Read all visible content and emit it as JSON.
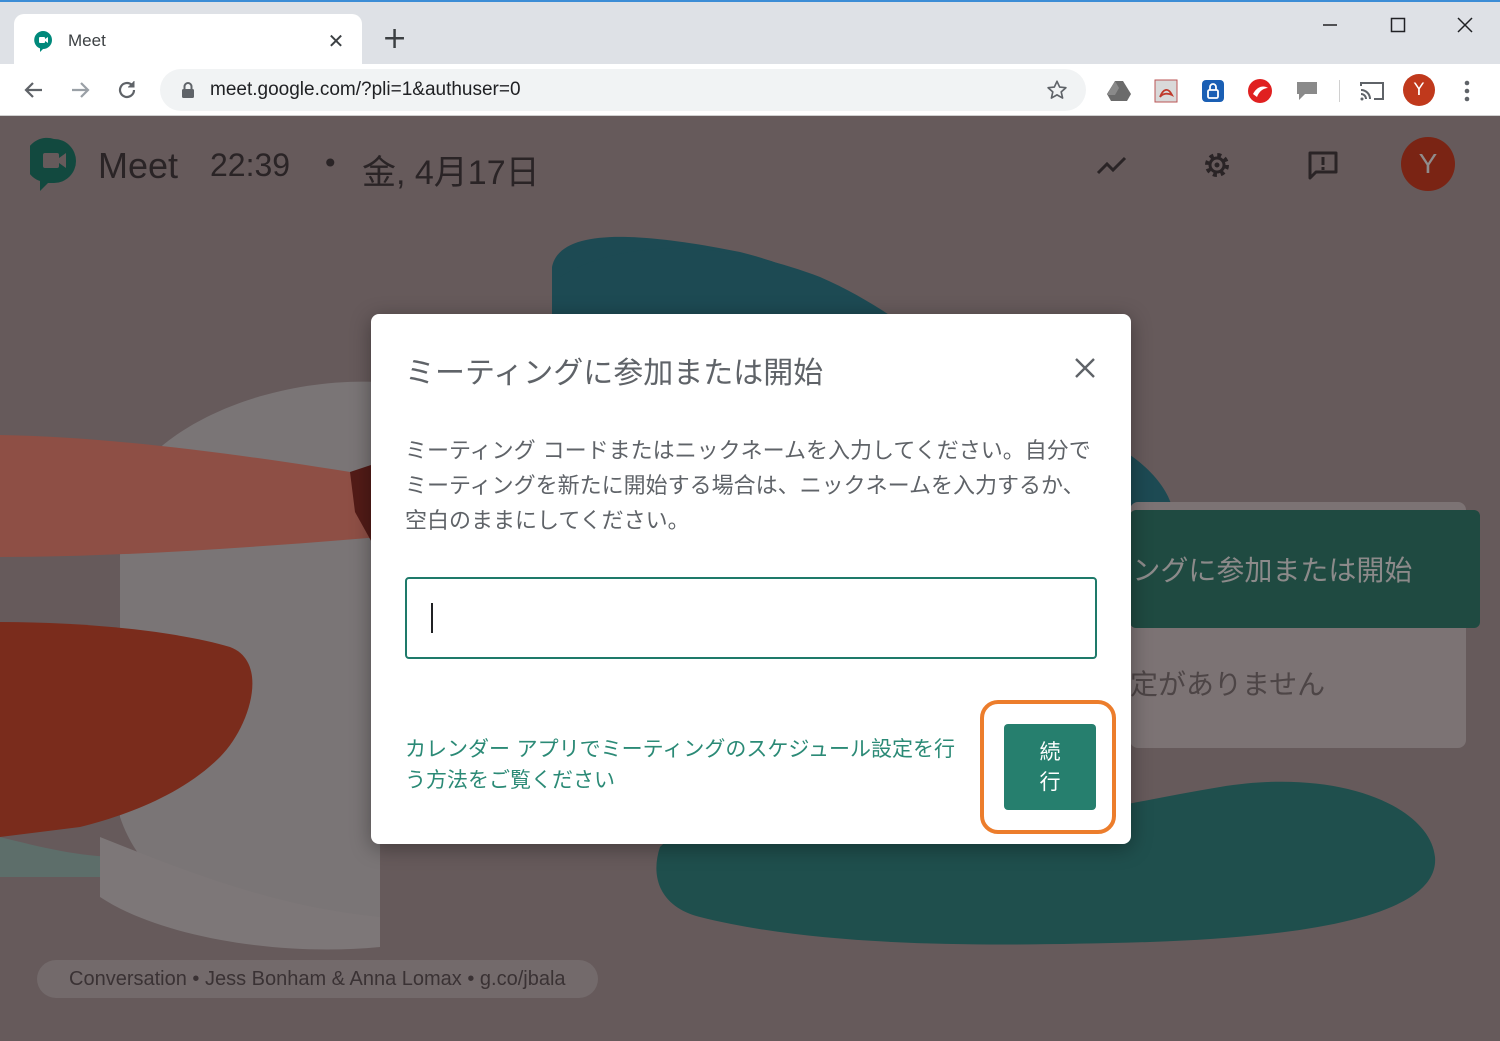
{
  "browser": {
    "tab_title": "Meet",
    "tab_close": "✕",
    "new_tab": "+",
    "url": "meet.google.com/?pli=1&authuser=0",
    "profile_initial": "Y"
  },
  "header": {
    "brand": "Meet",
    "time": "22:39",
    "separator": "•",
    "date": "金, 4月17日",
    "avatar_initial": "Y"
  },
  "background": {
    "join_button_label": "ミーティングに参加または開始",
    "no_schedule_text": "予定がありません",
    "footer_caption": "Conversation • Jess Bonham & Anna Lomax • g.co/jbala"
  },
  "dialog": {
    "title": "ミーティングに参加または開始",
    "description": "ミーティング コードまたはニックネームを入力してください。自分でミーティングを新たに開始する場合は、ニックネームを入力するか、空白のままにしてください。",
    "input_value": "",
    "input_placeholder": "",
    "help_link": "カレンダー アプリでミーティングのスケジュール設定を行う方法をご覧ください",
    "continue_label": "続行"
  },
  "colors": {
    "accent_teal": "#267f6e",
    "highlight_orange": "#ec7d2c",
    "overlay": "#665a5b"
  },
  "icons": {
    "meet_logo": "meet-logo-icon",
    "lock": "lock-icon",
    "star": "star-icon",
    "close": "close-icon"
  }
}
